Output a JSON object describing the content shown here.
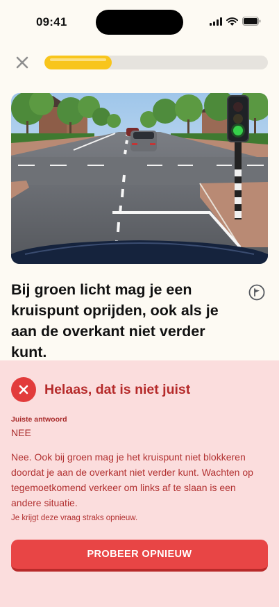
{
  "status_bar": {
    "time": "09:41",
    "icons": [
      "cellular-signal-icon",
      "wifi-icon",
      "battery-icon"
    ]
  },
  "top_bar": {
    "close_icon": "close-icon",
    "progress_fraction": 0.3
  },
  "question": {
    "text": "Bij groen licht mag je een kruispunt oprijden, ook als je aan de overkant niet verder kunt.",
    "flag_icon": "flag-icon"
  },
  "feedback": {
    "icon": "close-circle-icon",
    "title": "Helaas, dat is niet juist",
    "answer_label": "Juiste antwoord",
    "answer": "NEE",
    "explanation": "Nee. Ook bij groen mag je het kruispunt niet blokkeren doordat je aan de overkant niet verder kunt. Wachten op tegemoetkomend verkeer om links af te slaan is een andere situatie.",
    "note": "Je krijgt deze vraag straks opnieuw.",
    "retry_label": "PROBEER OPNIEUW"
  },
  "colors": {
    "background": "#fdfaf3",
    "progress_fill": "#f8c51c",
    "feedback_bg": "#fbdddd",
    "error": "#e23b3b",
    "error_text": "#b52a2a",
    "traffic_light_green": "#36d04a"
  }
}
